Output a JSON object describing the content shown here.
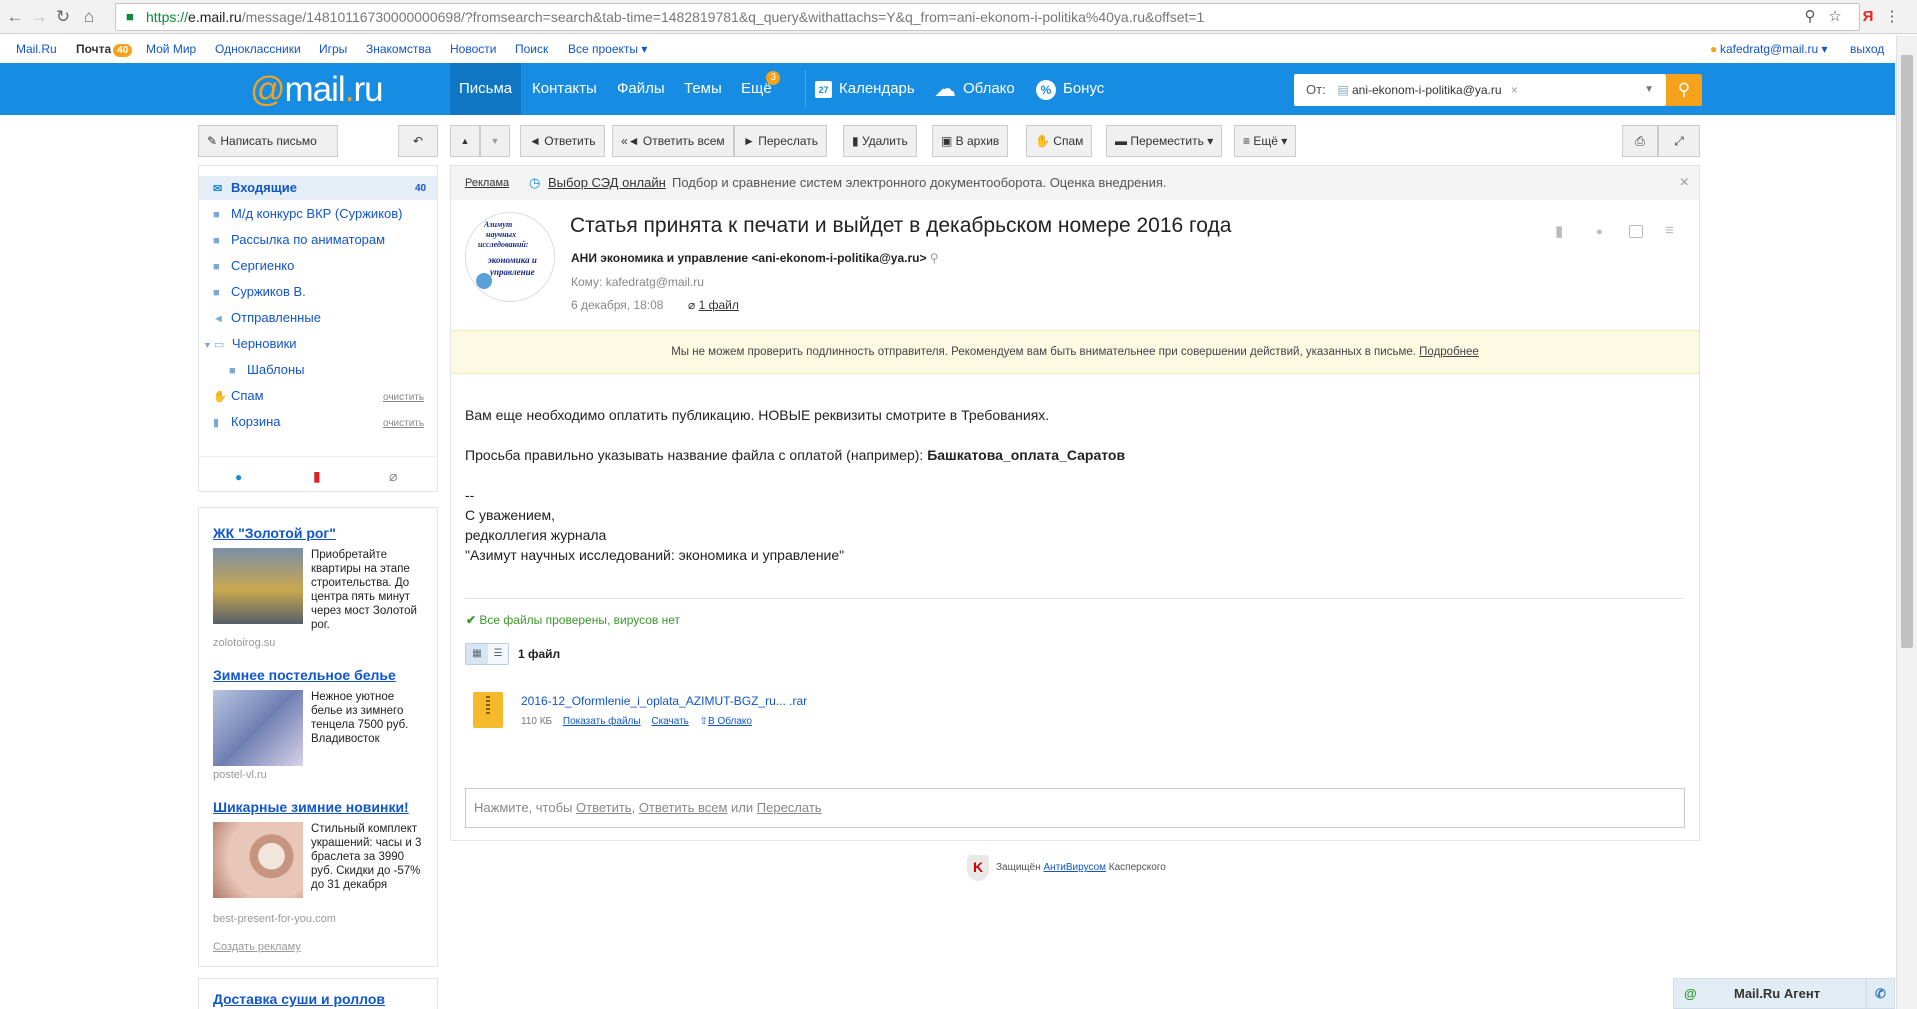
{
  "browser": {
    "url_prefix": "https://",
    "url_host": "e.mail.ru",
    "url_path": "/message/14810116730000000698/?fromsearch=search&tab-time=1482819781&q_query&withattachs=Y&q_from=ani-ekonom-i-politika%40ya.ru&offset=1",
    "yandex": "Я"
  },
  "portal": {
    "links": [
      "Mail.Ru",
      "Почта",
      "Мой Мир",
      "Одноклассники",
      "Игры",
      "Знакомства",
      "Новости",
      "Поиск",
      "Все проекты ▾"
    ],
    "mail_count": "40",
    "user": "kafedratg@mail.ru ▾",
    "logout": "выход"
  },
  "header": {
    "logo_at": "@",
    "logo_text": "mail",
    "logo_dot": ".",
    "logo_ru": "ru",
    "tabs": [
      "Письма",
      "Контакты",
      "Файлы",
      "Темы",
      "Ещё"
    ],
    "more_badge": "3",
    "calendar": "Календарь",
    "calendar_day": "27",
    "cloud": "Облако",
    "bonus": "Бонус",
    "search_from_label": "От:",
    "search_from_value": "ani-ekonom-i-politika@ya.ru",
    "search_clear": "×"
  },
  "toolbar": {
    "compose": "Написать письмо",
    "reply": "Ответить",
    "reply_all": "Ответить всем",
    "forward": "Переслать",
    "delete": "Удалить",
    "archive": "В архив",
    "spam": "Спам",
    "move": "Переместить ▾",
    "more": "≡ Ещё ▾"
  },
  "sidebar": {
    "folders": [
      {
        "label": "Входящие",
        "count": "40"
      },
      {
        "label": "М/д конкурс ВКР (Суржиков)"
      },
      {
        "label": "Рассылка по аниматорам"
      },
      {
        "label": "Сергиенко"
      },
      {
        "label": "Суржиков В."
      },
      {
        "label": "Отправленные"
      },
      {
        "label": "Черновики"
      },
      {
        "label": "Шаблоны"
      },
      {
        "label": "Спам",
        "clear": "очистить"
      },
      {
        "label": "Корзина",
        "clear": "очистить"
      }
    ]
  },
  "ads": [
    {
      "title": "ЖК \"Золотой рог\"",
      "text": "Приобретайте квартиры на этапе строительства. До центра пять минут через мост Золотой рог.",
      "domain": "zolotoirog.su"
    },
    {
      "title": "Зимнее постельное белье",
      "text": "Нежное уютное белье из зимнего тенцела 7500 руб. Владивосток",
      "domain": "postel-vl.ru"
    },
    {
      "title": "Шикарные зимние новинки!",
      "text": "Стильный комплект украшений: часы и 3 браслета за 3990 руб. Скидки до -57% до 31 декабря",
      "domain": "best-present-for-you.com"
    }
  ],
  "ads_create": "Создать рекламу",
  "ad_bottom_title": "Доставка суши и роллов",
  "adline": {
    "label": "Реклама",
    "link": "Выбор СЭД онлайн",
    "text": "Подбор и сравнение систем электронного документооборота. Оценка внедрения.",
    "close": "×"
  },
  "message": {
    "avatar_lines": [
      "Азимут",
      "научных",
      "исследований:",
      "экономика и",
      "управление"
    ],
    "subject": "Статья принята к печати и выйдет в декабрьском номере 2016 года",
    "from": "АНИ экономика и управление <ani-ekonom-i-politika@ya.ru>",
    "to": "Кому: kafedratg@mail.ru",
    "date": "6 декабря, 18:08",
    "attach_link": "1 файл",
    "warning": "Мы не можем проверить подлинность отправителя. Рекомендуем вам быть внимательнее при совершении действий, указанных в письме.",
    "warning_more": "Подробнее",
    "body1": "Вам еще необходимо оплатить публикацию. НОВЫЕ реквизиты смотрите в Требованиях.",
    "body2": "Просьба правильно указывать название файла с оплатой (например): ",
    "body2_bold": "Башкатова_оплата_Саратов",
    "sig_dash": "--",
    "sig1": "С уважением,",
    "sig2": "редколлегия журнала",
    "sig3": "\"Азимут научных исследований: экономика и управление\"",
    "virus_check": "Все файлы проверены, вирусов нет",
    "files_count": "1 файл",
    "file_name": "2016-12_Oformlenie_i_oplata_AZIMUT-BGZ_ru... .rar",
    "file_size": "110 КБ",
    "file_show": "Показать файлы",
    "file_download": "Скачать",
    "file_cloud": "В Облако",
    "reply_prefix": "Нажмите, чтобы ",
    "reply_a": "Ответить",
    "reply_b": "Ответить всем",
    "reply_or": " или ",
    "reply_c": "Переслать"
  },
  "footer": {
    "protected": "Защищён ",
    "antivirus": "АнтиВирусом",
    "kaspersky": " Касперского"
  },
  "agent": "Mail.Ru Агент"
}
